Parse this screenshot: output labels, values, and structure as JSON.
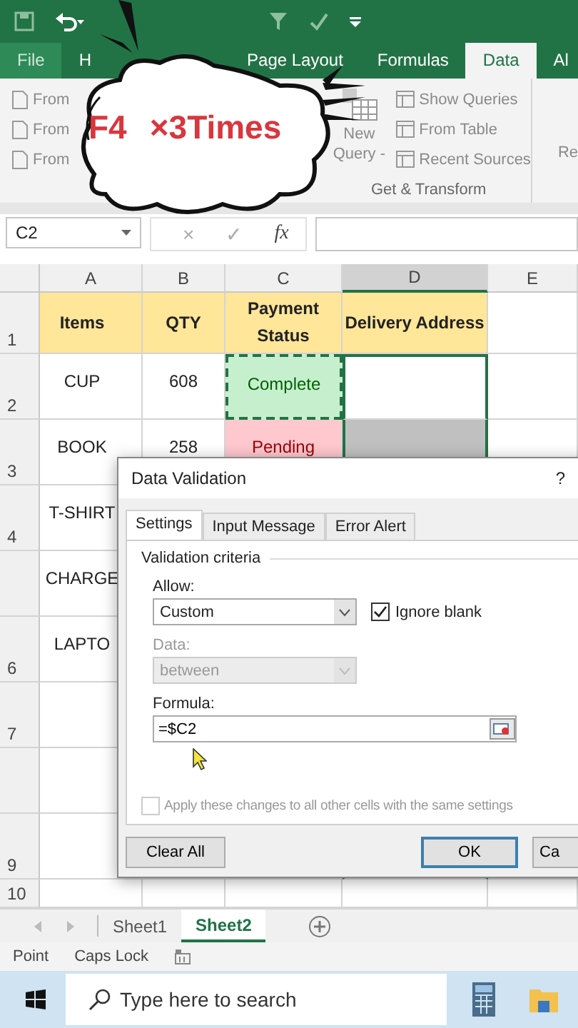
{
  "ribbon_tabs": [
    {
      "label": "File",
      "selected": false
    },
    {
      "label": "H",
      "selected": false
    },
    {
      "label": "Page Layout",
      "selected": false
    },
    {
      "label": "Formulas",
      "selected": false
    },
    {
      "label": "Data",
      "selected": true
    },
    {
      "label": "Al",
      "selected": false
    }
  ],
  "ribbon": {
    "left_items": [
      "From",
      "From",
      "From"
    ],
    "new_query": "New Query -",
    "group_items": [
      "Show Queries",
      "From Table",
      "Recent Sources"
    ],
    "group_label": "Get & Transform",
    "cut_item": "Re"
  },
  "callout": {
    "key": "F4",
    "text": "×3Times"
  },
  "formula_bar": {
    "name_box": "C2",
    "cancel": "×",
    "enter": "✓",
    "fx": "fx"
  },
  "columns": [
    {
      "label": "A",
      "selected": false
    },
    {
      "label": "B",
      "selected": false
    },
    {
      "label": "C",
      "selected": false
    },
    {
      "label": "D",
      "selected": true
    },
    {
      "label": "E",
      "selected": false
    }
  ],
  "rows": [
    {
      "label": "1",
      "kind": "header",
      "items": "Items",
      "qty": "QTY",
      "payment_status": {
        "text": "Payment Status"
      },
      "delivery_address": "Delivery Address",
      "delivery_selected": false
    },
    {
      "label": "2",
      "kind": "data",
      "items": "CUP",
      "qty": "608",
      "payment_status": {
        "text": "Complete",
        "kind": "complete",
        "copied": true
      },
      "delivery_selected": true
    },
    {
      "label": "3",
      "kind": "data",
      "items": "BOOK",
      "qty": "258",
      "payment_status": {
        "text": "Pending",
        "kind": "pending",
        "copied": false
      },
      "delivery_selected": true,
      "delivery_shaded": true
    },
    {
      "label": "4",
      "kind": "data",
      "items": "T-SHIRT"
    },
    {
      "kind": "data",
      "items": "CHARGE"
    },
    {
      "label": "6",
      "kind": "data",
      "items": "LAPTO"
    },
    {
      "label": "7",
      "kind": "data"
    },
    {
      "kind": "data"
    },
    {
      "label": "9",
      "kind": "data",
      "delivery_selected": true
    },
    {
      "label": "10",
      "kind": "data",
      "delivery_selected": false
    }
  ],
  "dialog": {
    "title": "Data Validation",
    "help": "?",
    "tabs": [
      {
        "label": "Settings",
        "selected": true
      },
      {
        "label": "Input Message",
        "selected": false
      },
      {
        "label": "Error Alert",
        "selected": false
      }
    ],
    "group_label": "Validation criteria",
    "allow": {
      "label": "Allow:",
      "value": "Custom"
    },
    "ignore_blank": {
      "label": "Ignore blank",
      "checked": true
    },
    "data": {
      "label": "Data:",
      "value": "between",
      "disabled": true
    },
    "formula": {
      "label": "Formula:",
      "value": "=$C2"
    },
    "apply_all": {
      "label": "Apply these changes to all other cells with the same settings",
      "checked": false,
      "disabled": true
    },
    "buttons": [
      {
        "label": "Clear All",
        "kind": "secondary"
      },
      {
        "label": "OK",
        "kind": "default"
      },
      {
        "label": "Ca",
        "kind": "secondary"
      }
    ]
  },
  "sheets": [
    {
      "label": "Sheet1",
      "selected": false
    },
    {
      "label": "Sheet2",
      "selected": true
    }
  ],
  "status_bar": [
    "Point",
    "Caps Lock"
  ],
  "taskbar": {
    "placeholder": "Type here to search"
  }
}
